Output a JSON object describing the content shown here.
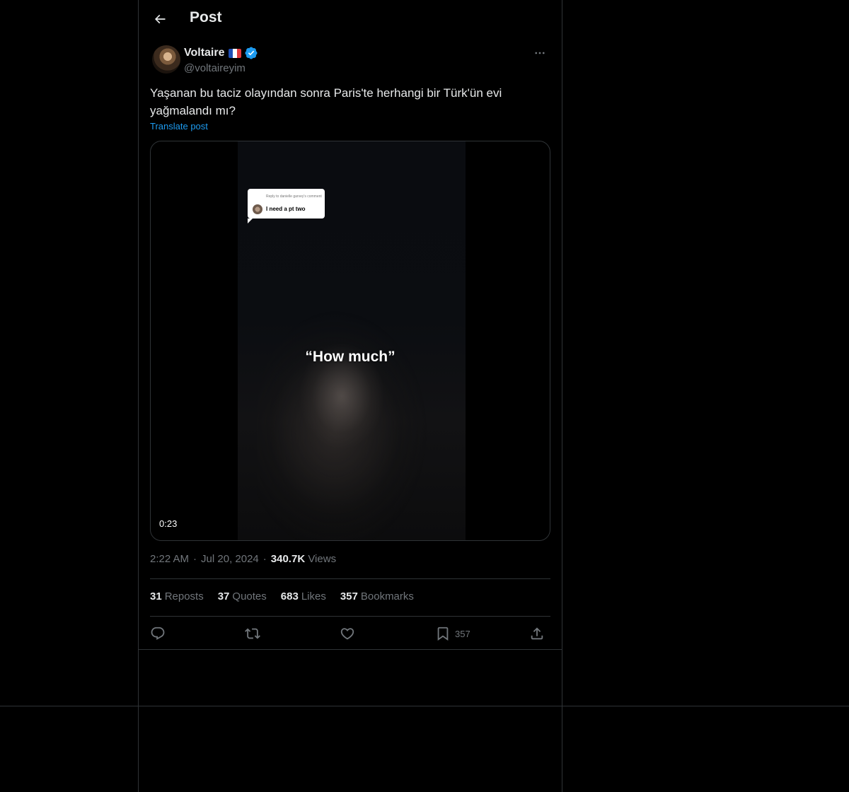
{
  "header": {
    "title": "Post",
    "back_icon": "arrow-left-icon"
  },
  "author": {
    "name": "Voltaire",
    "handle": "@voltaireyim",
    "flag": "france-flag-icon",
    "verified": true
  },
  "post": {
    "text": "Yaşanan bu taciz olayından sonra Paris'te herhangi bir Türk'ün evi yağmalandı mı?",
    "translate_label": "Translate post"
  },
  "media": {
    "type": "video",
    "duration": "0:23",
    "reply_sub": "Reply to danielle garvey's comment",
    "reply_text": "I need a pt two",
    "caption": "“How much”"
  },
  "meta": {
    "time": "2:22 AM",
    "date": "Jul 20, 2024",
    "views_count": "340.7K",
    "views_label": "Views",
    "separator": "·"
  },
  "stats": [
    {
      "count": "31",
      "label": "Reposts"
    },
    {
      "count": "37",
      "label": "Quotes"
    },
    {
      "count": "683",
      "label": "Likes"
    },
    {
      "count": "357",
      "label": "Bookmarks"
    }
  ],
  "actions": {
    "reply_icon": "reply-icon",
    "repost_icon": "repost-icon",
    "like_icon": "heart-icon",
    "bookmark_icon": "bookmark-icon",
    "bookmark_count": "357",
    "share_icon": "share-icon"
  },
  "colors": {
    "background": "#000000",
    "text": "#e7e9ea",
    "muted": "#71767b",
    "accent": "#1d9bf0",
    "border": "#2f3336"
  }
}
